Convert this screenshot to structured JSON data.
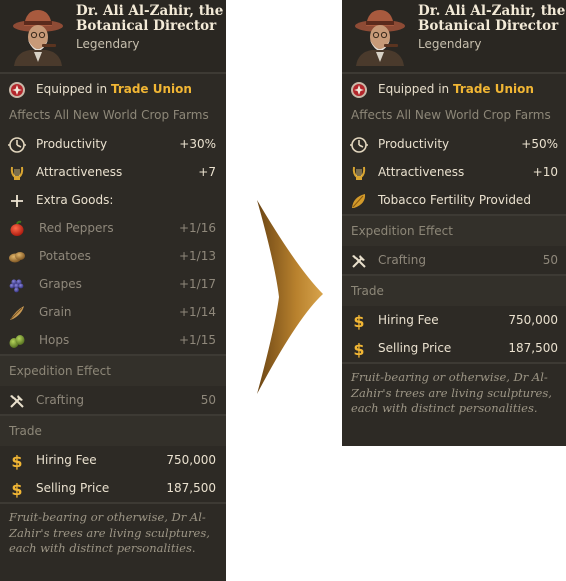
{
  "left": {
    "title": "Dr. Ali Al-Zahir, the Botanical Director",
    "rarity": "Legendary",
    "equipped_prefix": "Equipped in ",
    "equipped_place": "Trade Union",
    "affects": "Affects All New World Crop Farms",
    "stats": [
      {
        "label": "Productivity",
        "value": "+30%",
        "icon": "productivity-icon"
      },
      {
        "label": "Attractiveness",
        "value": "+7",
        "icon": "attractiveness-lyre-icon"
      }
    ],
    "extra_goods_label": "Extra Goods:",
    "extra_goods": [
      {
        "label": "Red Peppers",
        "value": "+1/16",
        "icon": "red-peppers-icon"
      },
      {
        "label": "Potatoes",
        "value": "+1/13",
        "icon": "potatoes-icon"
      },
      {
        "label": "Grapes",
        "value": "+1/17",
        "icon": "grapes-icon"
      },
      {
        "label": "Grain",
        "value": "+1/14",
        "icon": "grain-icon"
      },
      {
        "label": "Hops",
        "value": "+1/15",
        "icon": "hops-icon"
      }
    ],
    "expedition_title": "Expedition Effect",
    "expedition": {
      "label": "Crafting",
      "value": "50"
    },
    "trade_title": "Trade",
    "hiring_fee": {
      "label": "Hiring Fee",
      "value": "750,000"
    },
    "selling_price": {
      "label": "Selling Price",
      "value": "187,500"
    },
    "flavor": "Fruit-bearing or otherwise, Dr Al-Zahir's trees are living sculptures, each with distinct personalities."
  },
  "right": {
    "title": "Dr. Ali Al-Zahir, the Botanical Director",
    "rarity": "Legendary",
    "equipped_prefix": "Equipped in ",
    "equipped_place": "Trade Union",
    "affects": "Affects All New World Crop Farms",
    "stats": [
      {
        "label": "Productivity",
        "value": "+50%",
        "icon": "productivity-icon"
      },
      {
        "label": "Attractiveness",
        "value": "+10",
        "icon": "attractiveness-lyre-icon"
      }
    ],
    "extra": {
      "label": "Tobacco Fertility Provided",
      "icon": "tobacco-leaf-icon"
    },
    "expedition_title": "Expedition Effect",
    "expedition": {
      "label": "Crafting",
      "value": "50"
    },
    "trade_title": "Trade",
    "hiring_fee": {
      "label": "Hiring Fee",
      "value": "750,000"
    },
    "selling_price": {
      "label": "Selling Price",
      "value": "187,500"
    },
    "flavor": "Fruit-bearing or otherwise, Dr Al-Zahir's trees are living sculptures, each with distinct personalities."
  },
  "colors": {
    "panel_bg": "#2d2a25",
    "accent_gold": "#f1b634",
    "text": "#eae1cf",
    "dim_text": "#8f887b",
    "arrow": "#b07a2a"
  }
}
